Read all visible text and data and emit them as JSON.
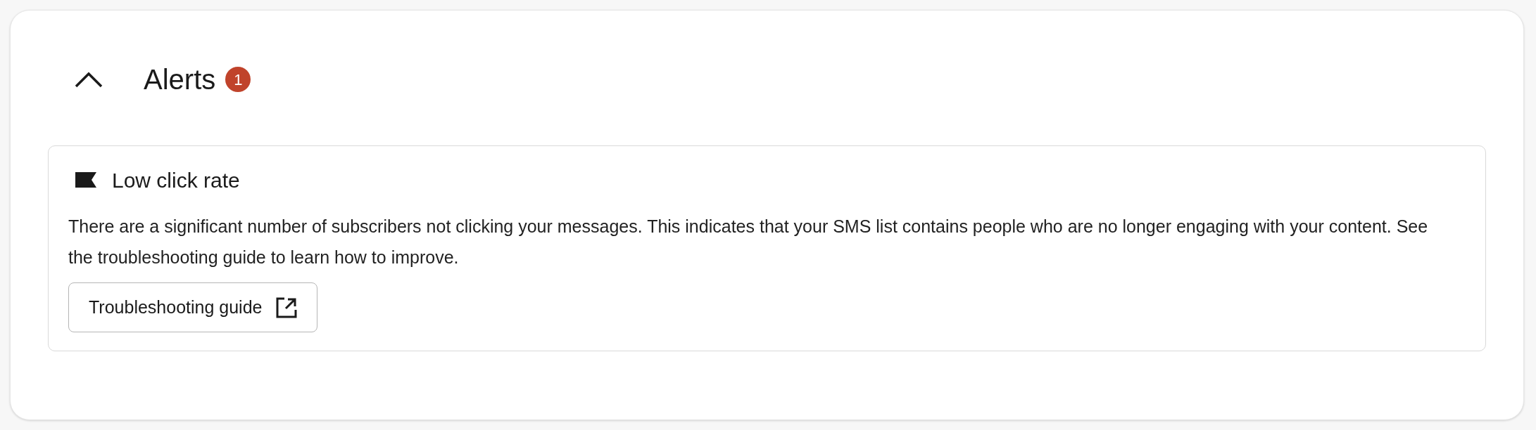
{
  "section": {
    "title": "Alerts",
    "badge": "1",
    "expanded": true
  },
  "alerts": [
    {
      "kind": "flag",
      "title": "Low click rate",
      "message": "There are a significant number of subscribers not clicking your messages. This indicates that your SMS list contains people who are no longer engaging with your content. See the troubleshooting guide to learn how to improve.",
      "button": "Troubleshooting guide"
    }
  ]
}
